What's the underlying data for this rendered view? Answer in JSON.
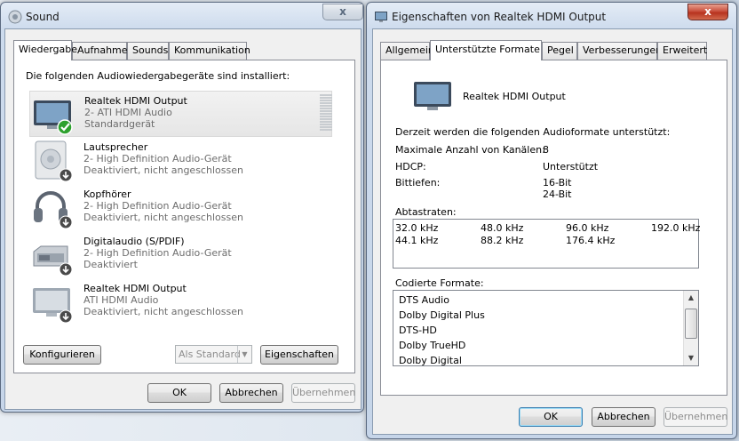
{
  "sound_window": {
    "title": "Sound",
    "close_label": "x",
    "tabs": [
      "Wiedergabe",
      "Aufnahme",
      "Sounds",
      "Kommunikation"
    ],
    "intro": "Die folgenden Audiowiedergabegeräte sind installiert:",
    "devices": [
      {
        "icon": "monitor-icon",
        "name": "Realtek HDMI Output",
        "line2": "2- ATI HDMI Audio",
        "line3": "Standardgerät",
        "status": "default-checkmark"
      },
      {
        "icon": "speaker-icon",
        "name": "Lautsprecher",
        "line2": "2- High Definition Audio-Gerät",
        "line3": "Deaktiviert, nicht angeschlossen",
        "status": "disabled-arrow"
      },
      {
        "icon": "headphones-icon",
        "name": "Kopfhörer",
        "line2": "2- High Definition Audio-Gerät",
        "line3": "Deaktiviert, nicht angeschlossen",
        "status": "disabled-arrow"
      },
      {
        "icon": "digital-audio-icon",
        "name": "Digitalaudio (S/PDIF)",
        "line2": "2- High Definition Audio-Gerät",
        "line3": "Deaktiviert",
        "status": "disabled-arrow"
      },
      {
        "icon": "monitor-icon",
        "name": "Realtek HDMI Output",
        "line2": "ATI HDMI Audio",
        "line3": "Deaktiviert, nicht angeschlossen",
        "status": "disabled-arrow"
      }
    ],
    "configure_label": "Konfigurieren",
    "set_default_label": "Als Standard",
    "properties_label": "Eigenschaften",
    "ok_label": "OK",
    "cancel_label": "Abbrechen",
    "apply_label": "Übernehmen"
  },
  "props_window": {
    "title": "Eigenschaften von Realtek HDMI Output",
    "close_label": "x",
    "tabs": [
      "Allgemein",
      "Unterstützte Formate",
      "Pegel",
      "Verbesserungen",
      "Erweitert"
    ],
    "device_name": "Realtek HDMI Output",
    "intro": "Derzeit werden die folgenden Audioformate unterstützt:",
    "max_channels_label": "Maximale Anzahl von Kanälen:",
    "max_channels_value": "8",
    "hdcp_label": "HDCP:",
    "hdcp_value": "Unterstützt",
    "bitdepth_label": "Bittiefen:",
    "bitdepth_values": [
      "16-Bit",
      "24-Bit"
    ],
    "samplerates_label": "Abtastraten:",
    "samplerates": [
      [
        "32.0 kHz",
        "48.0 kHz",
        "96.0 kHz",
        "192.0 kHz"
      ],
      [
        "44.1 kHz",
        "88.2 kHz",
        "176.4 kHz"
      ]
    ],
    "encoded_label": "Codierte Formate:",
    "encoded_formats": [
      "DTS Audio",
      "Dolby Digital Plus",
      "DTS-HD",
      "Dolby TrueHD",
      "Dolby Digital"
    ],
    "ok_label": "OK",
    "cancel_label": "Abbrechen",
    "apply_label": "Übernehmen"
  },
  "colors": {
    "accent_check": "#2ea12e",
    "selection": "#e6e6e6",
    "close_red": "#c94f3c"
  }
}
